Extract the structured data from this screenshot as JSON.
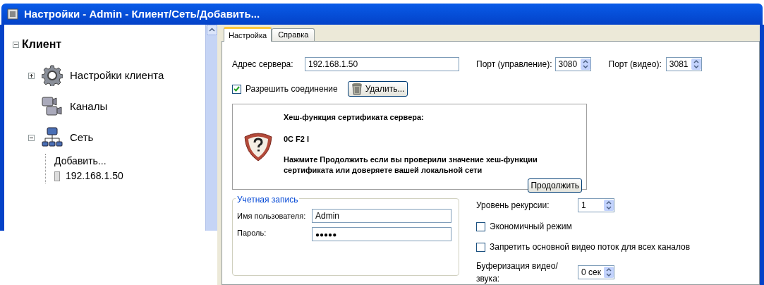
{
  "window": {
    "title": "Настройки - Admin - Клиент/Сеть/Добавить..."
  },
  "tree": {
    "label": "Клиент",
    "expanded": true,
    "children": [
      {
        "label": "Настройки клиента",
        "kind": "gear",
        "expanded": false,
        "has_children": true
      },
      {
        "label": "Каналы",
        "kind": "cameras",
        "has_children": false
      },
      {
        "label": "Сеть",
        "kind": "network",
        "expanded": true,
        "has_children": true,
        "children": [
          {
            "label": "Добавить...",
            "kind": "none"
          },
          {
            "label": "192.168.1.50",
            "kind": "server"
          }
        ]
      }
    ]
  },
  "tabs": [
    {
      "label": "Настройка",
      "selected": true
    },
    {
      "label": "Справка",
      "selected": false
    }
  ],
  "server": {
    "address_label": "Адрес сервера:",
    "address": "192.168.1.50",
    "control_port_label": "Порт (управление):",
    "control_port": "3080",
    "video_port_label": "Порт (видео):",
    "video_port": "3081"
  },
  "allow_connection": {
    "label": "Разрешить соединение",
    "checked": true
  },
  "delete_button": "Удалить...",
  "certificate": {
    "heading": "Хеш-функция сертификата сервера:",
    "hash": "0C F2 I",
    "message": "Нажмите Продолжить если вы проверили значение хеш-функции сертификата или доверяете вашей локальной сети",
    "button": "Продолжить"
  },
  "account": {
    "title": "Учетная запись",
    "username_label": "Имя пользователя:",
    "username": "Admin",
    "password_label": "Пароль:",
    "password": "●●●●●"
  },
  "options": [
    {
      "kind": "spin",
      "label": "Уровень рекурсии:",
      "value": "1"
    },
    {
      "kind": "checkbox",
      "label": "Экономичный режим",
      "checked": false
    },
    {
      "kind": "checkbox",
      "label": "Запретить основной видео поток для всех каналов",
      "checked": false
    },
    {
      "kind": "spin",
      "label": "Буферизация видео/звука:",
      "value": "0 сек"
    }
  ]
}
